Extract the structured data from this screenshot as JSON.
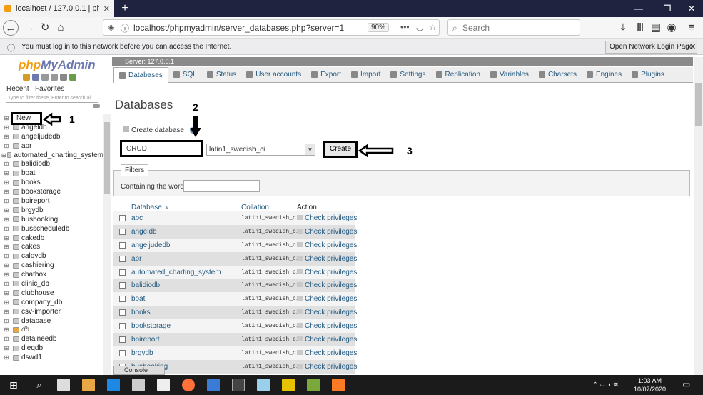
{
  "browser": {
    "tab_title": "localhost / 127.0.0.1 | phpMyAd",
    "url": "localhost/phpmyadmin/server_databases.php?server=1",
    "zoom": "90%",
    "search_placeholder": "Search",
    "notice_text": "You must log in to this network before you can access the Internet.",
    "notice_button": "Open Network Login Page"
  },
  "sidebar": {
    "logo_php": "php",
    "logo_myadmin": "MyAdmin",
    "tab_recent": "Recent",
    "tab_favorites": "Favorites",
    "filter_placeholder": "Type to filter these, Enter to search all",
    "new_label": "New",
    "databases": [
      "abc",
      "angeldb",
      "angeljudedb",
      "apr",
      "automated_charting_system",
      "balidiodb",
      "boat",
      "books",
      "bookstorage",
      "bpireport",
      "brgydb",
      "busbooking",
      "busscheduledb",
      "cakedb",
      "cakes",
      "caloydb",
      "cashiering",
      "chatbox",
      "clinic_db",
      "clubhouse",
      "company_db",
      "csv-importer",
      "database",
      "db",
      "detaineedb",
      "dieqdb",
      "dswd1"
    ]
  },
  "main": {
    "server_label": "Server: 127.0.0.1",
    "menu": [
      {
        "label": "Databases",
        "active": true
      },
      {
        "label": "SQL"
      },
      {
        "label": "Status"
      },
      {
        "label": "User accounts"
      },
      {
        "label": "Export"
      },
      {
        "label": "Import"
      },
      {
        "label": "Settings"
      },
      {
        "label": "Replication"
      },
      {
        "label": "Variables"
      },
      {
        "label": "Charsets"
      },
      {
        "label": "Engines"
      },
      {
        "label": "Plugins"
      }
    ],
    "heading": "Databases",
    "create_label": "Create database",
    "db_name_value": "CRUD",
    "collation_value": "latin1_swedish_ci",
    "create_button": "Create",
    "filters_label": "Filters",
    "containing_label": "Containing the word:",
    "table_headers": {
      "database": "Database",
      "collation": "Collation",
      "action": "Action"
    },
    "rows": [
      {
        "name": "abc",
        "collation": "latin1_swedish_ci",
        "action": "Check privileges"
      },
      {
        "name": "angeldb",
        "collation": "latin1_swedish_ci",
        "action": "Check privileges"
      },
      {
        "name": "angeljudedb",
        "collation": "latin1_swedish_ci",
        "action": "Check privileges"
      },
      {
        "name": "apr",
        "collation": "latin1_swedish_ci",
        "action": "Check privileges"
      },
      {
        "name": "automated_charting_system",
        "collation": "latin1_swedish_ci",
        "action": "Check privileges"
      },
      {
        "name": "balidiodb",
        "collation": "latin1_swedish_ci",
        "action": "Check privileges"
      },
      {
        "name": "boat",
        "collation": "latin1_swedish_ci",
        "action": "Check privileges"
      },
      {
        "name": "books",
        "collation": "latin1_swedish_ci",
        "action": "Check privileges"
      },
      {
        "name": "bookstorage",
        "collation": "latin1_swedish_ci",
        "action": "Check privileges"
      },
      {
        "name": "bpireport",
        "collation": "latin1_swedish_ci",
        "action": "Check privileges"
      },
      {
        "name": "brgydb",
        "collation": "latin1_swedish_ci",
        "action": "Check privileges"
      },
      {
        "name": "busbooking",
        "collation": "latin1_swedish_ci",
        "action": "Check privileges"
      }
    ],
    "console_label": "Console"
  },
  "annotations": {
    "one": "1",
    "two": "2",
    "three": "3"
  },
  "taskbar": {
    "time": "1:03 AM",
    "date": "10/07/2020"
  }
}
